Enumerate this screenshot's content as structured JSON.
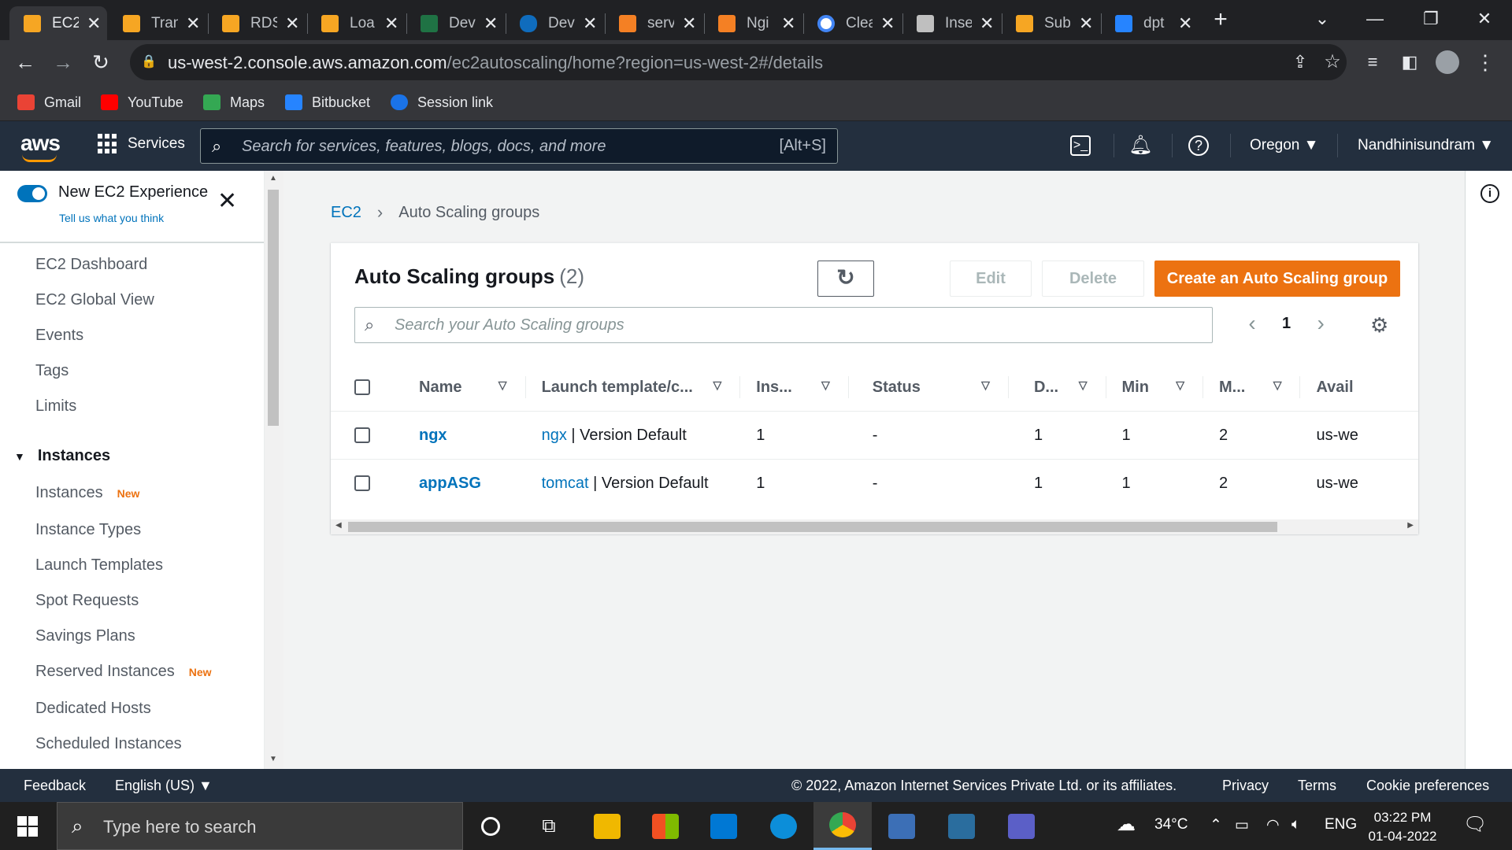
{
  "browser": {
    "tabs": [
      {
        "title": "EC2",
        "icon": "aws-box-icon",
        "color": "#f6a623",
        "active": true
      },
      {
        "title": "Tran",
        "icon": "aws-box-icon",
        "color": "#f6a623"
      },
      {
        "title": "RDS",
        "icon": "aws-box-icon",
        "color": "#f6a623"
      },
      {
        "title": "Loa",
        "icon": "aws-box-icon",
        "color": "#f6a623"
      },
      {
        "title": "Dev",
        "icon": "excel-icon",
        "color": "#1f7244"
      },
      {
        "title": "Dev",
        "icon": "onedrive-icon",
        "color": "#0f6cbd"
      },
      {
        "title": "serv",
        "icon": "stackoverflow-icon",
        "color": "#f48024"
      },
      {
        "title": "Ngi",
        "icon": "stackoverflow-icon",
        "color": "#f48024"
      },
      {
        "title": "Clea",
        "icon": "google-icon",
        "color": "#ffffff"
      },
      {
        "title": "Inse",
        "icon": "image-icon",
        "color": "#bfbfbf"
      },
      {
        "title": "Sub",
        "icon": "aws-box-icon",
        "color": "#f6a623"
      },
      {
        "title": "dpt",
        "icon": "bitbucket-icon",
        "color": "#2684ff"
      }
    ],
    "url_host": "us-west-2.console.aws.amazon.com",
    "url_path": "/ec2autoscaling/home?region=us-west-2#/details",
    "bookmarks": [
      {
        "label": "Gmail",
        "color": "#ea4335"
      },
      {
        "label": "YouTube",
        "color": "#ff0000"
      },
      {
        "label": "Maps",
        "color": "#34a853"
      },
      {
        "label": "Bitbucket",
        "color": "#2684ff"
      },
      {
        "label": "Session link",
        "color": "#1a73e8"
      }
    ]
  },
  "aws_nav": {
    "logo": "aws",
    "services": "Services",
    "search_placeholder": "Search for services, features, blogs, docs, and more",
    "search_shortcut": "[Alt+S]",
    "region": "Oregon ▼",
    "account": "Nandhinisundram ▼"
  },
  "sidebar": {
    "toggle_title": "New EC2 Experience",
    "toggle_link": "Tell us what you think",
    "items_top": [
      "EC2 Dashboard",
      "EC2 Global View",
      "Events",
      "Tags",
      "Limits"
    ],
    "section_instances": "Instances",
    "instances_items": [
      {
        "label": "Instances",
        "badge": "New"
      },
      {
        "label": "Instance Types",
        "badge": ""
      },
      {
        "label": "Launch Templates",
        "badge": ""
      },
      {
        "label": "Spot Requests",
        "badge": ""
      },
      {
        "label": "Savings Plans",
        "badge": ""
      },
      {
        "label": "Reserved Instances",
        "badge": "New"
      },
      {
        "label": "Dedicated Hosts",
        "badge": ""
      },
      {
        "label": "Scheduled Instances",
        "badge": ""
      }
    ]
  },
  "breadcrumb": {
    "root": "EC2",
    "current": "Auto Scaling groups"
  },
  "panel": {
    "title": "Auto Scaling groups",
    "count": "(2)",
    "edit": "Edit",
    "delete": "Delete",
    "create": "Create an Auto Scaling group",
    "search_placeholder": "Search your Auto Scaling groups",
    "page": "1"
  },
  "table": {
    "columns": [
      "Name",
      "Launch template/c...",
      "Ins...",
      "Status",
      "D...",
      "Min",
      "M...",
      "Avail"
    ],
    "rows": [
      {
        "name": "ngx",
        "template": "ngx",
        "version": "| Version Default",
        "instances": "1",
        "status": "-",
        "desired": "1",
        "min": "1",
        "max": "2",
        "avail": "us-we"
      },
      {
        "name": "appASG",
        "template": "tomcat",
        "version": "| Version Default",
        "instances": "1",
        "status": "-",
        "desired": "1",
        "min": "1",
        "max": "2",
        "avail": "us-we"
      }
    ]
  },
  "footer": {
    "feedback": "Feedback",
    "language": "English (US) ▼",
    "copyright": "© 2022, Amazon Internet Services Private Ltd. or its affiliates.",
    "privacy": "Privacy",
    "terms": "Terms",
    "cookies": "Cookie preferences"
  },
  "taskbar": {
    "search_placeholder": "Type here to search",
    "weather": "34°C",
    "language": "ENG",
    "time": "03:22 PM",
    "date": "01-04-2022"
  },
  "colors": {
    "accent": "#ec7211",
    "link": "#0073bb",
    "nav": "#232f3e"
  }
}
